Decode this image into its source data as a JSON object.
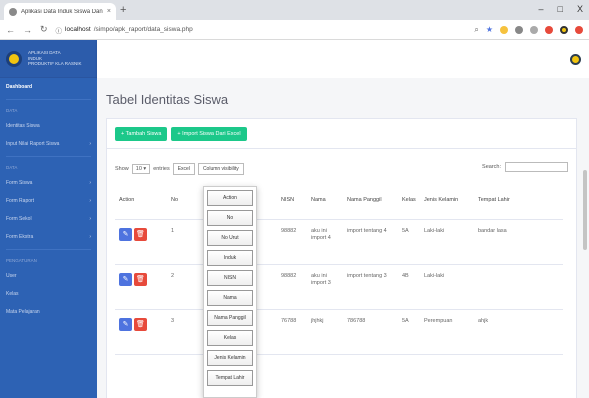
{
  "browser": {
    "tab_title": "Aplikasi Data Induk Siswa Dan R",
    "tab_close": "×",
    "new_tab": "+",
    "url_host": "localhost",
    "url_path": "/simpo/apk_raport/data_siswa.php",
    "win_min": "–",
    "win_max": "□",
    "win_close": "X"
  },
  "sidebar": {
    "brand_line1": "Aplikasi data",
    "brand_line2": "induk",
    "brand_line3": "Produktif Kla Rasnik",
    "dashboard": "Dashboard",
    "head1": "Data",
    "items": [
      {
        "label": "Identitas Siswa",
        "arrow": ""
      },
      {
        "label": "Input Nilai Raport Siswa",
        "arrow": "›"
      }
    ],
    "head2": "Data",
    "items2": [
      {
        "label": "Form Siswa",
        "arrow": "›"
      },
      {
        "label": "Form Raport",
        "arrow": "›"
      },
      {
        "label": "Form Sekol",
        "arrow": "›"
      },
      {
        "label": "Form Ekstra",
        "arrow": "›"
      }
    ],
    "head3": "Pengaturan",
    "items3": [
      {
        "label": "User"
      },
      {
        "label": "Kelas"
      },
      {
        "label": "Mata Pelajaran"
      }
    ]
  },
  "page": {
    "title": "Tabel Identitas Siswa",
    "btn_add": "+ Tambah Siswa",
    "btn_import": "+ Import Siswa Dari Excel",
    "show_label": "Show",
    "entries_value": "10",
    "entries_label": "entries",
    "btn_excel": "Excel",
    "btn_colvis": "Column visibility",
    "search_label": "Search:"
  },
  "table": {
    "headers": [
      "Action",
      "No",
      "",
      "NISN",
      "Nama",
      "Nama Panggil",
      "Kelas",
      "Jenis Kelamin",
      "Tempat Lahir"
    ],
    "rows": [
      {
        "no": "1",
        "nisn": "98882",
        "nama": "aku ini import 4",
        "panggil": "import tentang 4",
        "kelas": "5A",
        "jk": "Laki-laki",
        "tempat": "bandar lasa"
      },
      {
        "no": "2",
        "nisn": "98882",
        "nama": "aku ini import 3",
        "panggil": "import tentang 3",
        "kelas": "4B",
        "jk": "Laki-laki",
        "tempat": ""
      },
      {
        "no": "3",
        "nisn": "76788",
        "nama": "jhjhkj",
        "panggil": "786788",
        "kelas": "5A",
        "jk": "Perempuan",
        "tempat": "ahjk"
      }
    ],
    "edit_icon": "✎",
    "delete_icon": "🗑"
  },
  "colvis": [
    "Action",
    "No",
    "No Urut",
    "Induk",
    "NISN",
    "Nama",
    "Nama Panggil",
    "Kelas",
    "Jenis Kelamin",
    "Tempat Lahir"
  ],
  "colors": {
    "sidebar": "#2d62b4",
    "green": "#1cc88a",
    "blue": "#4e73df",
    "red": "#e74a3b"
  }
}
